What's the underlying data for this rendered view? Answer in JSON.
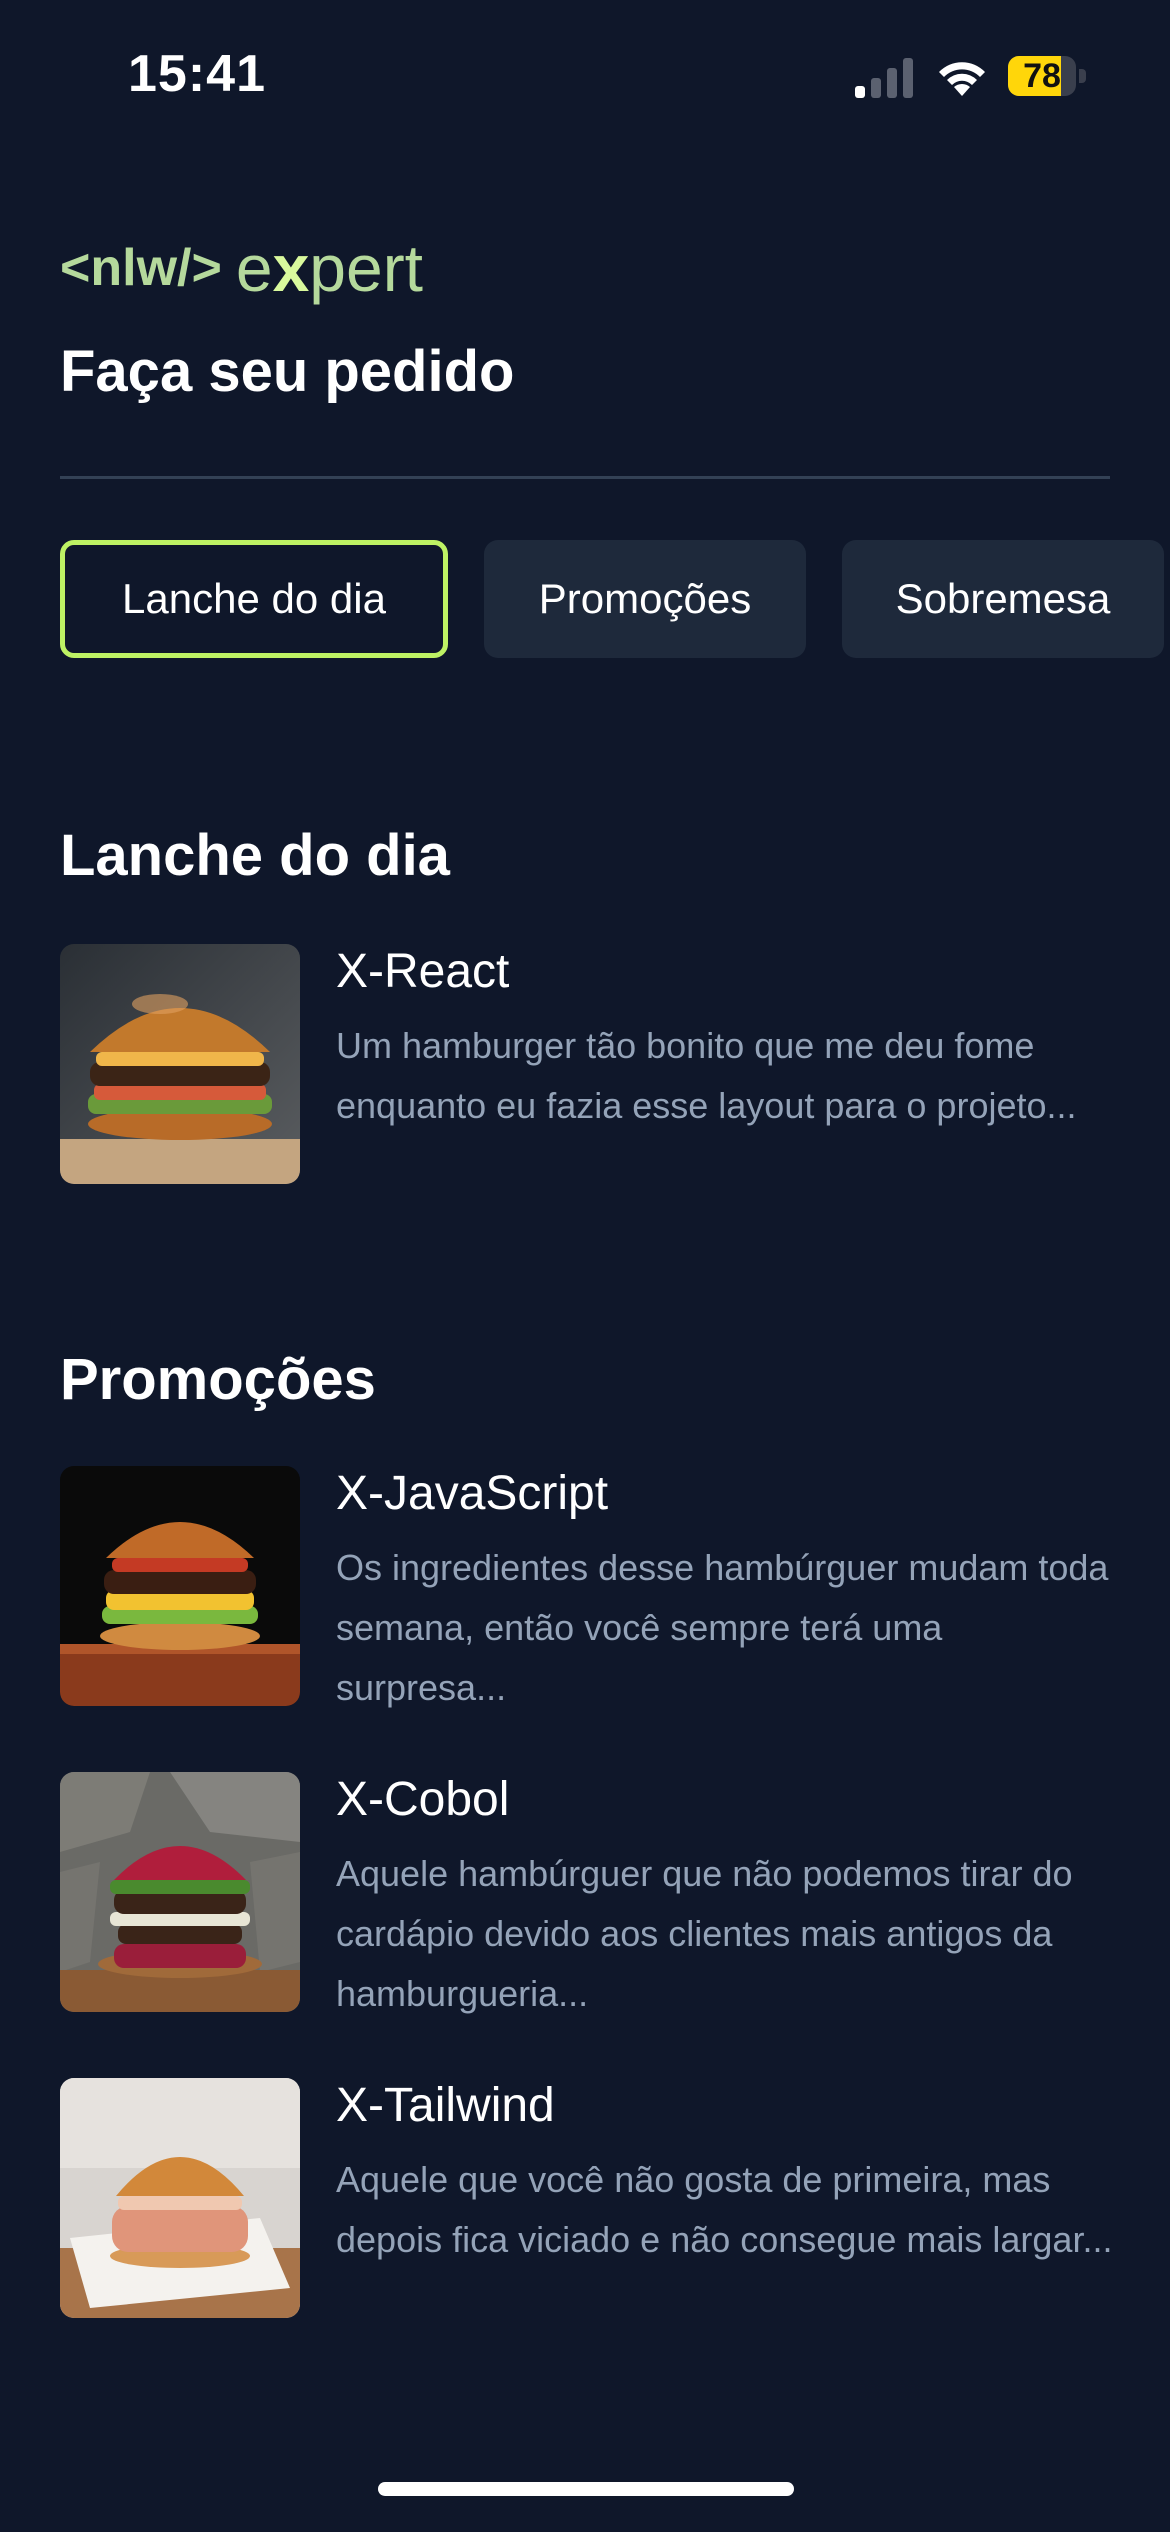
{
  "status_bar": {
    "time": "15:41",
    "battery_level": "78",
    "battery_color": "#ffd60a",
    "icons": [
      "signal-icon",
      "wifi-icon",
      "battery-icon"
    ]
  },
  "header": {
    "logo_brand": "<nlw/>",
    "logo_word_prefix": "e",
    "logo_word_x": "x",
    "logo_word_suffix": "pert",
    "title": "Faça seu pedido"
  },
  "tabs": [
    {
      "label": "Lanche do dia",
      "active": true
    },
    {
      "label": "Promoções",
      "active": false
    },
    {
      "label": "Sobremesa",
      "active": false
    }
  ],
  "sections": [
    {
      "title": "Lanche do dia",
      "items": [
        {
          "title": "X-React",
          "description": "Um hamburger tão bonito que me deu fome enquanto eu fazia esse layout para o projeto..."
        }
      ]
    },
    {
      "title": "Promoções",
      "items": [
        {
          "title": "X-JavaScript",
          "description": "Os ingredientes desse hambúrguer mudam toda semana, então você sempre terá uma surpresa..."
        },
        {
          "title": "X-Cobol",
          "description": "Aquele hambúrguer que não podemos tirar do cardápio devido aos clientes mais antigos da hamburgueria..."
        },
        {
          "title": "X-Tailwind",
          "description": "Aquele que você não gosta de primeira, mas depois fica viciado e não consegue mais largar..."
        }
      ]
    }
  ],
  "theme": {
    "background": "#0f172a",
    "accent": "#bef264",
    "tab_background": "#1e293b",
    "muted_text": "#94a3b8"
  }
}
